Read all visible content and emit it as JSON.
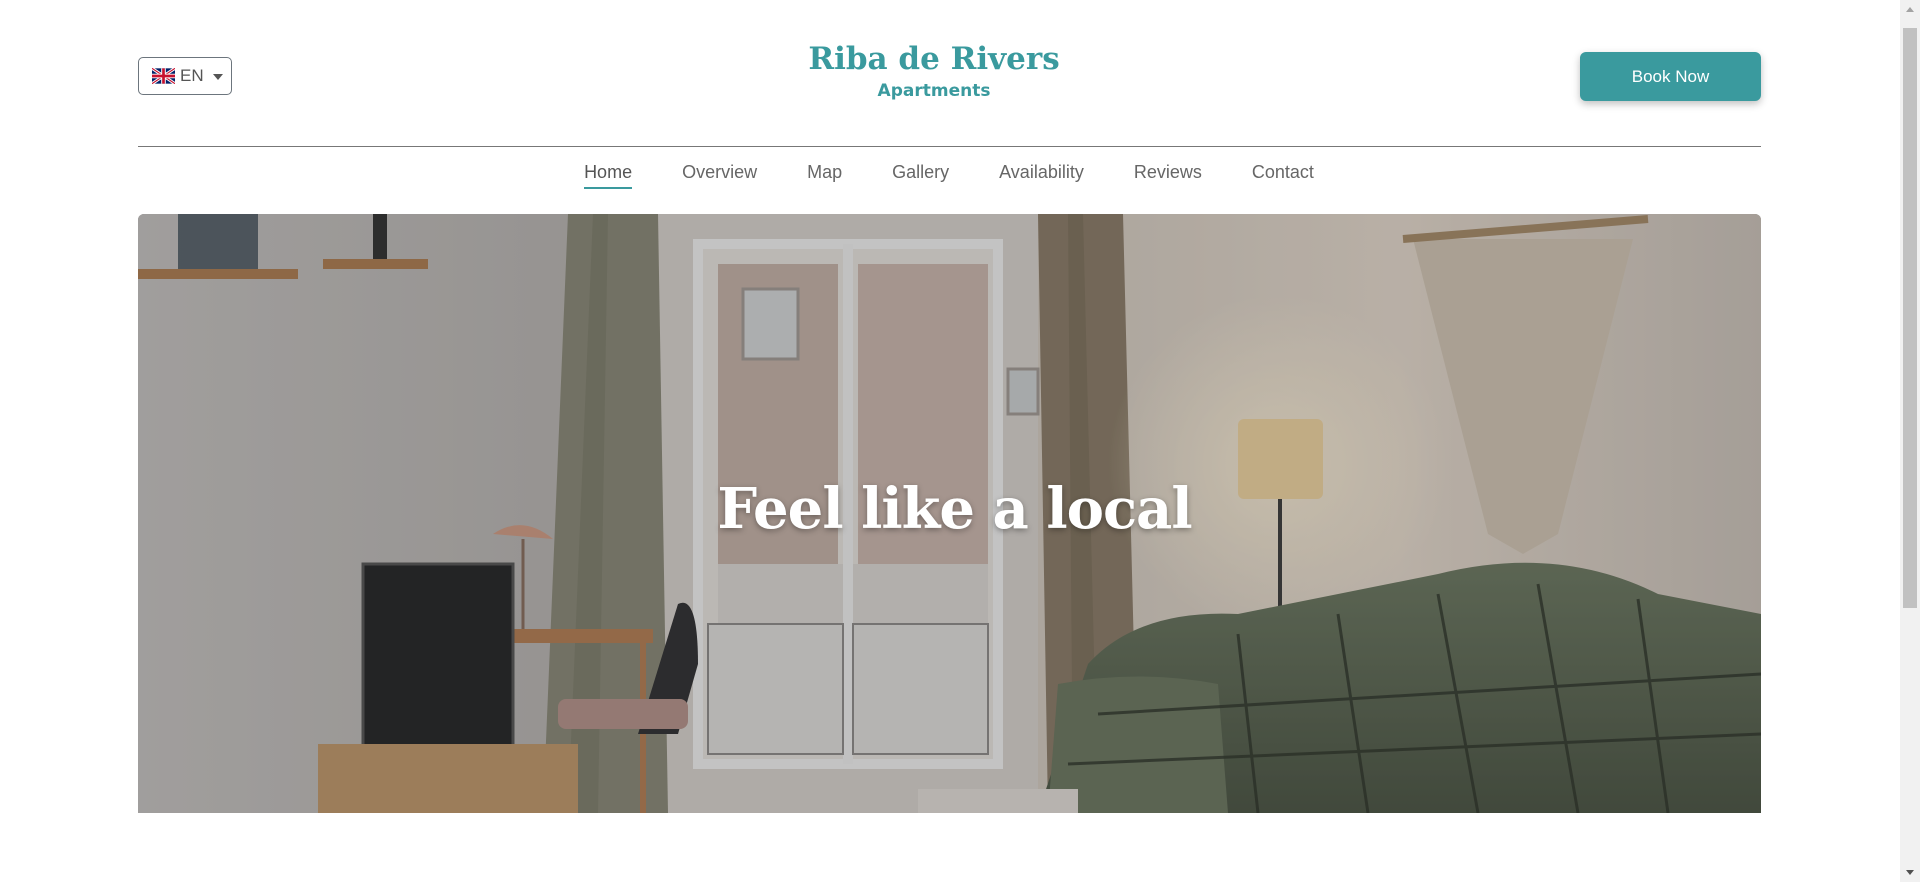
{
  "header": {
    "language": {
      "label": "EN",
      "flag_icon": "uk-flag-icon"
    },
    "brand": {
      "title": "Riba de Rivers",
      "subtitle": "Apartments",
      "color": "#3a9a9e"
    },
    "book_label": "Book Now"
  },
  "nav": {
    "items": [
      {
        "label": "Home",
        "active": true
      },
      {
        "label": "Overview"
      },
      {
        "label": "Map"
      },
      {
        "label": "Gallery"
      },
      {
        "label": "Availability"
      },
      {
        "label": "Reviews"
      },
      {
        "label": "Contact"
      }
    ]
  },
  "hero": {
    "title": "Feel like a local",
    "image": "apartment-living-room-photo"
  }
}
